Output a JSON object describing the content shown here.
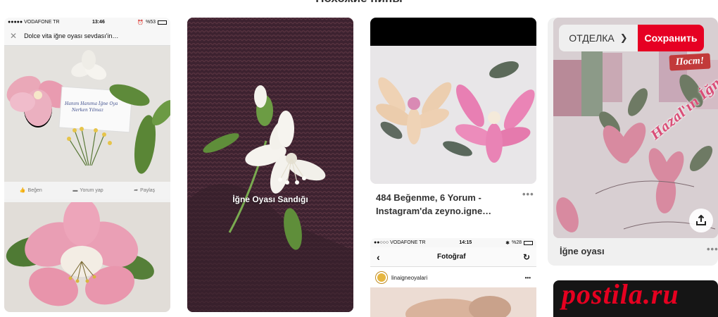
{
  "page_heading": "Похожие пины",
  "pins": [
    {
      "phone": {
        "carrier": "●●●●● VODAFONE TR",
        "time": "13:46",
        "battery": "%53",
        "post_title": "Dolce vita iğne oyası sevdası'in…",
        "card_text": [
          "Hanım Hanıma İğne Oya",
          "Nerken Yılmaz"
        ],
        "actions": {
          "like": "Beğen",
          "comment": "Yorum yap",
          "share": "Paylaş"
        }
      }
    },
    {
      "overlay_title": "İğne Oyası Sandığı"
    },
    {
      "title": "484 Beğenme, 6 Yorum - Instagram'da zeyno.igne…",
      "more": "•••",
      "phone": {
        "carrier": "●●○○○ VODAFONE TR",
        "time": "14:15",
        "battery": "%28",
        "nav_title": "Fotoğraf",
        "username": "linaigneoyalari",
        "more": "•••"
      }
    },
    {
      "board_select_label": "ОТДЕЛКА",
      "save_label": "Сохранить",
      "badge_text": "Пост!",
      "photo_text": "Hazal'ın İğne Aşkı",
      "title": "İğne oyası",
      "more": "•••"
    }
  ],
  "watermark": "postila.ru",
  "colors": {
    "save_red": "#e60023",
    "watermark_red": "#e60020"
  }
}
